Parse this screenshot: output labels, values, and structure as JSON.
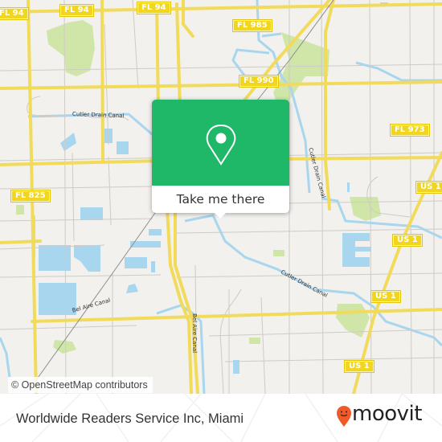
{
  "map": {
    "route_shields": [
      {
        "id": "fl94-left",
        "label": "FL 94"
      },
      {
        "id": "fl94-mid",
        "label": "FL 94"
      },
      {
        "id": "fl94-right",
        "label": "FL 94"
      },
      {
        "id": "fl985",
        "label": "FL 985"
      },
      {
        "id": "fl990",
        "label": "FL 990"
      },
      {
        "id": "fl973",
        "label": "FL 973"
      },
      {
        "id": "fl825",
        "label": "FL 825"
      },
      {
        "id": "us1-a",
        "label": "US 1"
      },
      {
        "id": "us1-b",
        "label": "US 1"
      },
      {
        "id": "us1-c",
        "label": "US 1"
      },
      {
        "id": "us1-d",
        "label": "US 1"
      }
    ],
    "waterway_labels": [
      {
        "id": "cutler-drain-canal-1",
        "label": "Cutler Drain Canal"
      },
      {
        "id": "cutler-drain-canal-2",
        "label": "Cutler Drain Canal"
      },
      {
        "id": "cutler-drain-canal-3",
        "label": "Cutler Drain Canal"
      },
      {
        "id": "bel-aire-canal-1",
        "label": "Bel Aire Canal"
      },
      {
        "id": "bel-aire-canal-2",
        "label": "Bel Aire Canal"
      }
    ],
    "attribution": "© OpenStreetMap contributors",
    "colors": {
      "land": "#f2f1ee",
      "major_road": "#f6e27a",
      "minor_road": "#c9c6c0",
      "water": "#a8d6ee",
      "park": "#cfe6a8"
    }
  },
  "popup": {
    "icon": "map-pin-icon",
    "button_label": "Take me there",
    "accent_color": "#1fb868"
  },
  "footer": {
    "place_title": "Worldwide Readers Service Inc, Miami",
    "brand_name": "moovit",
    "brand_color": "#f05a28"
  }
}
